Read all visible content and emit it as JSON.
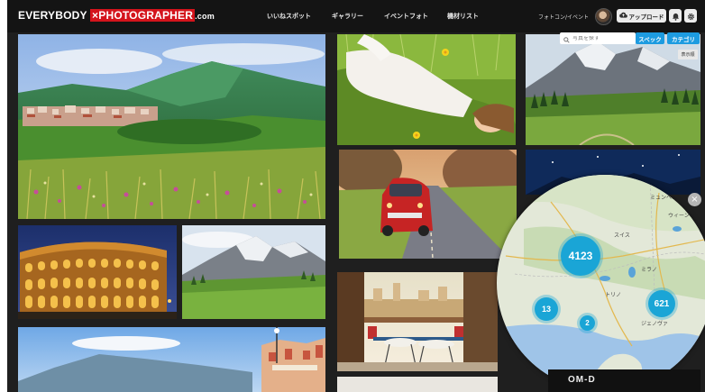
{
  "header": {
    "logo_part1": "EVERYBODY ",
    "logo_x": "×",
    "logo_part2": "PHOTOGRAPHER",
    "logo_part3": ".com",
    "nav": [
      "いいねスポット",
      "ギャラリー",
      "イベントフォト",
      "機材リスト"
    ],
    "events_link": "フォトコン/イベント",
    "upload_label": "アップロード"
  },
  "search": {
    "placeholder": "写真を探す",
    "spec_label": "スペック",
    "category_label": "カテゴリ"
  },
  "photo_badge": "表示順",
  "map": {
    "clusters": [
      "4123",
      "13",
      "2",
      "621"
    ],
    "labels": [
      "スイス",
      "ミラノ",
      "トリノ",
      "ジェノヴァ",
      "ウィーン",
      "ミュンヘン"
    ],
    "close_label": "×"
  },
  "ad_text": "OM-D",
  "colors": {
    "brand_red": "#d4141c",
    "accent_blue": "#1d9be0",
    "cluster_blue": "#1aa5d6"
  }
}
